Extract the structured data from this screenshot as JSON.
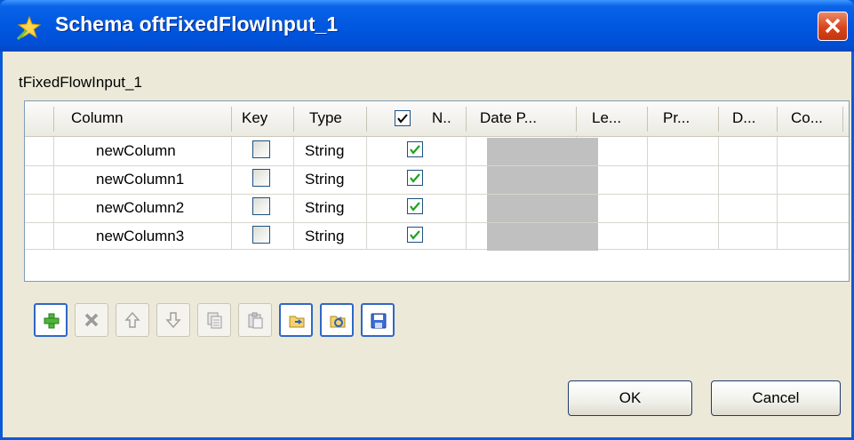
{
  "window": {
    "title": "Schema oftFixedFlowInput_1"
  },
  "subtitle": "tFixedFlowInput_1",
  "table": {
    "columns": [
      "Column",
      "Key",
      "Type",
      "N..",
      "Date P...",
      "Le...",
      "Pr...",
      "D...",
      "Co..."
    ],
    "rows": [
      {
        "column": "newColumn",
        "key": false,
        "type": "String",
        "nullable": true
      },
      {
        "column": "newColumn1",
        "key": false,
        "type": "String",
        "nullable": true
      },
      {
        "column": "newColumn2",
        "key": false,
        "type": "String",
        "nullable": true
      },
      {
        "column": "newColumn3",
        "key": false,
        "type": "String",
        "nullable": true
      }
    ]
  },
  "toolbar": {
    "buttons": [
      "add-icon",
      "delete-icon",
      "move-up-icon",
      "move-down-icon",
      "copy-icon",
      "paste-icon",
      "import-icon",
      "export-icon",
      "save-icon"
    ]
  },
  "buttons": {
    "ok": "OK",
    "cancel": "Cancel"
  },
  "colors": {
    "title_bar": "#0057e0",
    "close_button": "#d8451c",
    "check": "#21a121",
    "disabled_cell": "#c0c0c0"
  }
}
